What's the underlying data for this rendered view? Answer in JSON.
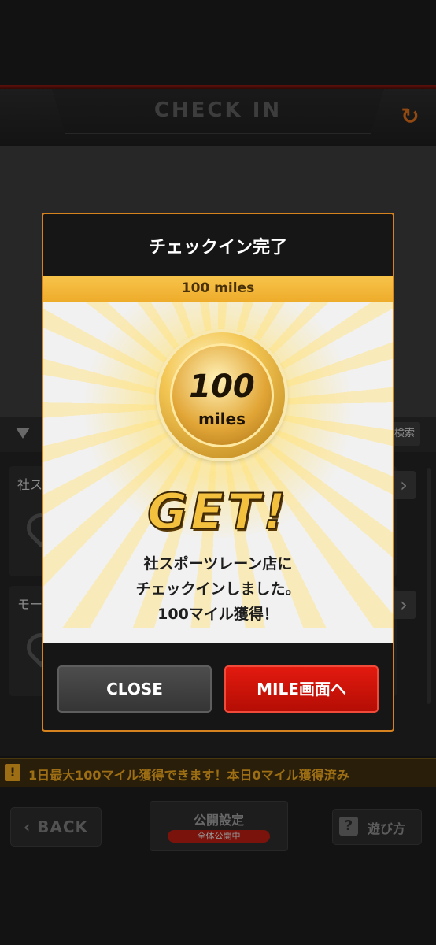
{
  "header": {
    "title": "CHECK IN"
  },
  "filter": {
    "search_label": "検索"
  },
  "cards": [
    {
      "caption": "社ス"
    },
    {
      "caption": "モー"
    }
  ],
  "notice": {
    "text": "1日最大100マイル獲得できます！本日0マイル獲得済み"
  },
  "bottom": {
    "back_label": "BACK",
    "public_title": "公開設定",
    "public_badge": "全体公開中",
    "help_label": "遊び方"
  },
  "modal": {
    "title": "チェックイン完了",
    "reward_bar": "100 miles",
    "coin_value": "100",
    "coin_unit": "miles",
    "get_label": "GET!",
    "message_line1": "社スポーツレーン店に",
    "message_line2": "チェックインしました。",
    "message_line3": "100マイル獲得！",
    "close_label": "CLOSE",
    "mile_label": "MILE画面へ"
  },
  "colors": {
    "accent_orange": "#d6821e",
    "reward_gold": "#f7c44b",
    "mile_red": "#e31a0f"
  }
}
